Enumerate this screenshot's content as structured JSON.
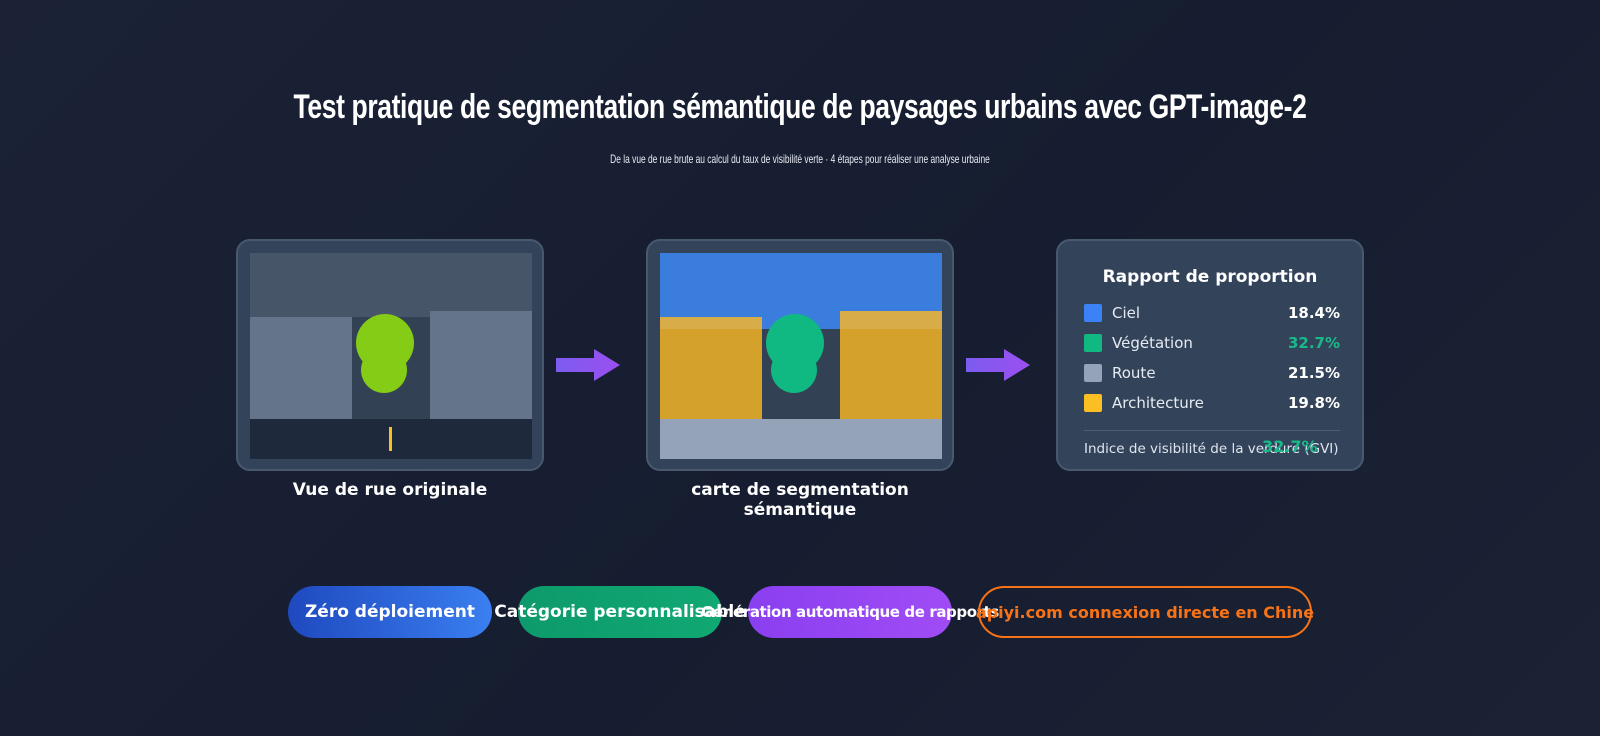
{
  "header": {
    "title": "Test pratique de segmentation sémantique de paysages urbains avec GPT-image-2",
    "subtitle": "De la vue de rue brute au calcul du taux de visibilité verte · 4 étapes pour réaliser une analyse urbaine"
  },
  "steps": {
    "original": {
      "label": "Vue de rue originale"
    },
    "segmentation": {
      "label": "carte de segmentation sémantique"
    },
    "report": {
      "title": "Rapport de proportion",
      "rows": [
        {
          "name": "Ciel",
          "value": "18.4%",
          "color": "#3b82f6"
        },
        {
          "name": "Végétation",
          "value": "32.7%",
          "color": "#10b981",
          "highlight": true
        },
        {
          "name": "Route",
          "value": "21.5%",
          "color": "#94a3b8"
        },
        {
          "name": "Architecture",
          "value": "19.8%",
          "color": "#fbbf24"
        }
      ],
      "gvi_label": "Indice de visibilité de la verdure (GVI)",
      "gvi_value": "32.7%"
    }
  },
  "colors": {
    "sky": "#3b82f6",
    "vegetation": "#10b981",
    "road": "#94a3b8",
    "architecture": "#fbbf24",
    "tree_original": "#84cc16",
    "arrow": "#8b5cf6",
    "accent_orange": "#f97316"
  },
  "features": [
    {
      "label": "Zéro déploiement"
    },
    {
      "label": "Catégorie personnalisable"
    },
    {
      "label": "Génération automatique de rapports"
    },
    {
      "label": "apiyi.com connexion directe en Chine"
    }
  ]
}
